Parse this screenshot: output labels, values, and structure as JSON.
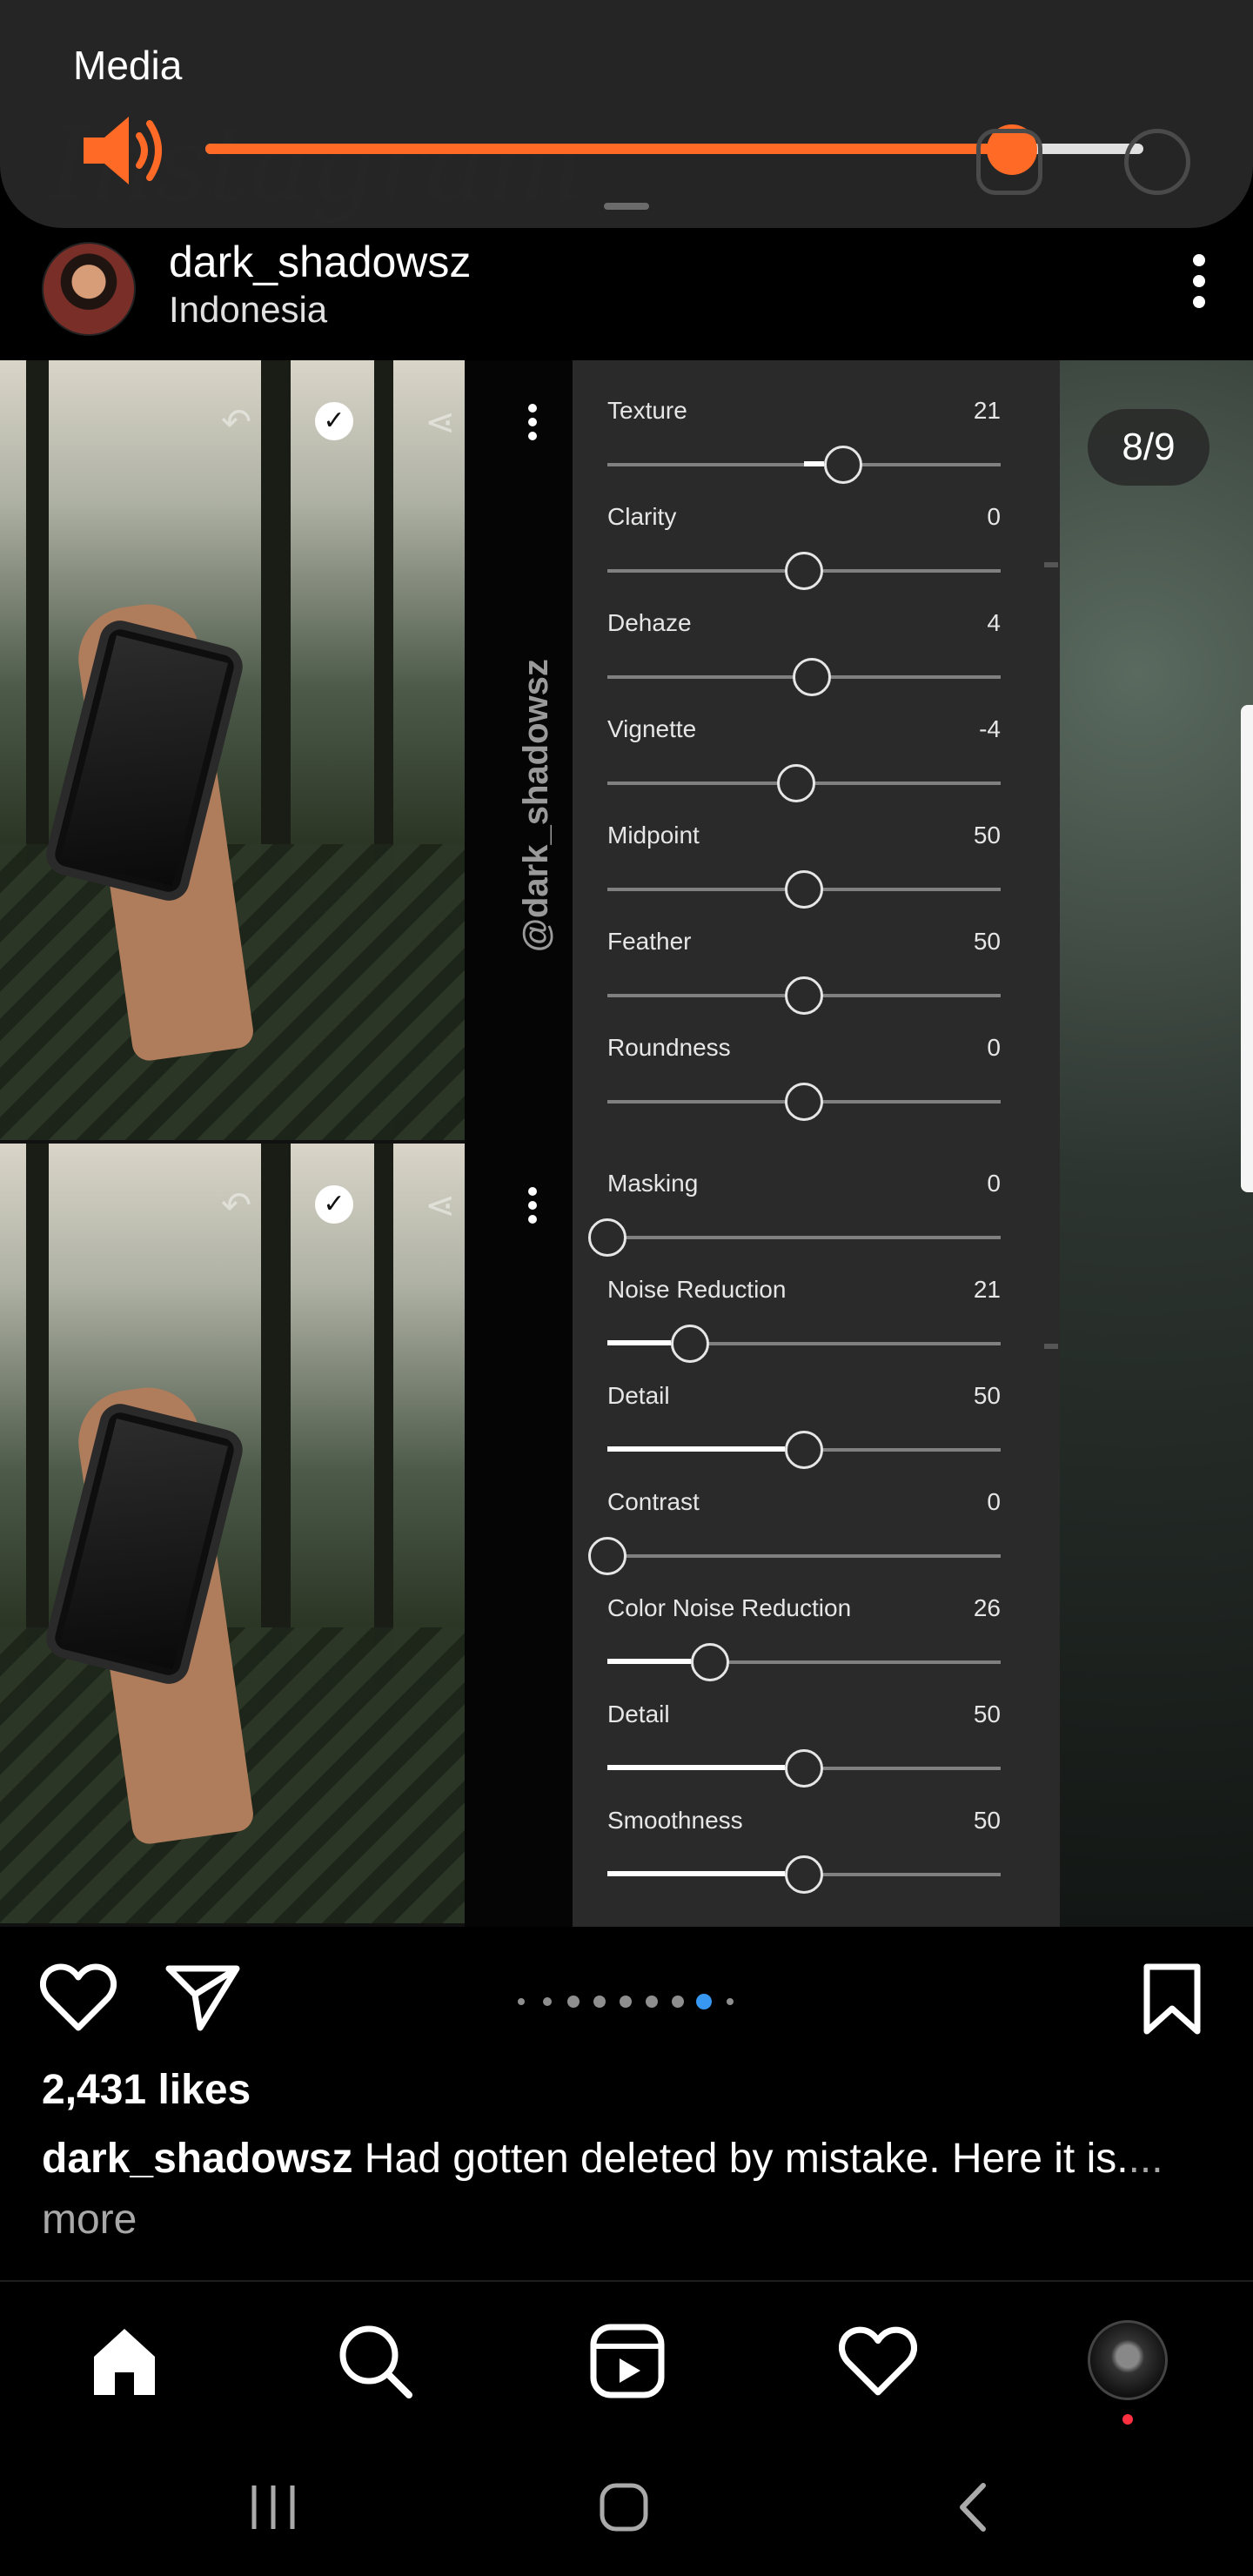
{
  "media_panel": {
    "label": "Media",
    "volume_fraction": 0.86,
    "accent_color": "#ff6a26"
  },
  "post": {
    "username": "dark_shadowsz",
    "location": "Indonesia",
    "counter": "8/9",
    "watermark": "@dark_shadowsz",
    "carousel": {
      "total": 9,
      "active_index": 7
    }
  },
  "edit_panel": {
    "sliders": [
      {
        "label": "Texture",
        "value": "21",
        "position": 0.6,
        "fill": false
      },
      {
        "label": "Clarity",
        "value": "0",
        "position": 0.5,
        "fill": false
      },
      {
        "label": "Dehaze",
        "value": "4",
        "position": 0.52,
        "fill": false
      },
      {
        "label": "Vignette",
        "value": "-4",
        "position": 0.48,
        "fill": false
      },
      {
        "label": "Midpoint",
        "value": "50",
        "position": 0.5,
        "fill": false
      },
      {
        "label": "Feather",
        "value": "50",
        "position": 0.5,
        "fill": false
      },
      {
        "label": "Roundness",
        "value": "0",
        "position": 0.5,
        "fill": false
      },
      {
        "label": "Masking",
        "value": "0",
        "position": 0.0,
        "fill": true
      },
      {
        "label": "Noise Reduction",
        "value": "21",
        "position": 0.21,
        "fill": true
      },
      {
        "label": "Detail",
        "value": "50",
        "position": 0.5,
        "fill": true
      },
      {
        "label": "Contrast",
        "value": "0",
        "position": 0.0,
        "fill": true
      },
      {
        "label": "Color Noise Reduction",
        "value": "26",
        "position": 0.26,
        "fill": true
      },
      {
        "label": "Detail",
        "value": "50",
        "position": 0.5,
        "fill": true
      },
      {
        "label": "Smoothness",
        "value": "50",
        "position": 0.5,
        "fill": true
      }
    ]
  },
  "actions": {
    "likes": "2,431 likes",
    "caption_user": "dark_shadowsz",
    "caption_text": " Had gotten deleted by mistake. Here it is.",
    "caption_more": "... more"
  },
  "icons": {
    "like": "heart-icon",
    "share": "paper-plane-icon",
    "save": "bookmark-icon",
    "home": "home-icon",
    "search": "search-icon",
    "reels": "reels-icon",
    "activity": "heart-icon",
    "profile": "profile-avatar"
  },
  "colors": {
    "background": "#000000",
    "panel": "#2a2a2a",
    "carousel_active": "#3897f0",
    "notification": "#ff3040"
  }
}
